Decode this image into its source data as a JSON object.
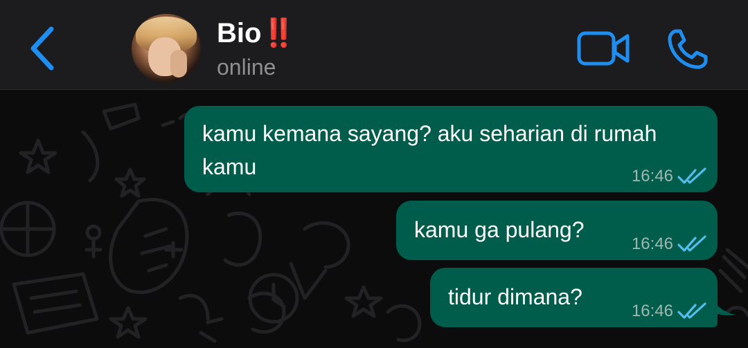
{
  "header": {
    "contact_name": "Bio",
    "contact_emoji": "‼️",
    "status": "online",
    "icons": {
      "back": "chevron-left-icon",
      "video": "video-camera-icon",
      "call": "phone-icon"
    },
    "accent_color": "#1f8ef1"
  },
  "messages": [
    {
      "text": "kamu kemana sayang? aku seharian di rumah kamu",
      "time": "16:46",
      "status": "read"
    },
    {
      "text": "kamu ga pulang?",
      "time": "16:46",
      "status": "read"
    },
    {
      "text": "tidur dimana?",
      "time": "16:46",
      "status": "read"
    }
  ],
  "colors": {
    "outgoing_bubble": "#005c4b",
    "header_bg": "#1c1c1e",
    "chat_bg": "#0c0c0c",
    "read_tick": "#53bdeb"
  }
}
